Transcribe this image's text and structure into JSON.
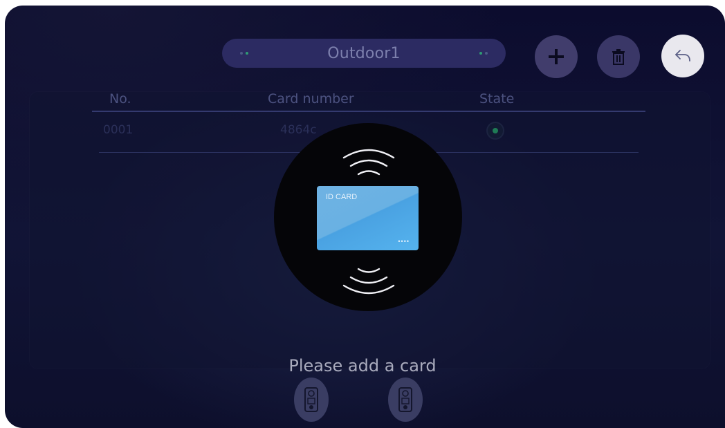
{
  "header": {
    "title": "Outdoor1",
    "buttons": {
      "add_icon": "plus-icon",
      "delete_icon": "trash-icon",
      "back_icon": "back-arrow-icon"
    }
  },
  "table": {
    "columns": [
      "No.",
      "Card number",
      "State"
    ],
    "rows": [
      {
        "no": "0001",
        "card_number": "4864c",
        "state": "active"
      }
    ]
  },
  "dialog": {
    "card_label": "ID CARD",
    "card_dots": "••••",
    "prompt": "Please add a card"
  },
  "footer": {
    "icons": [
      "outdoor-station-icon",
      "outdoor-station-icon"
    ]
  },
  "colors": {
    "background": "#0c0c2e",
    "pill": "#2c2b62",
    "accent_green": "#2f9b74",
    "card_blue": "#5aaae6"
  }
}
